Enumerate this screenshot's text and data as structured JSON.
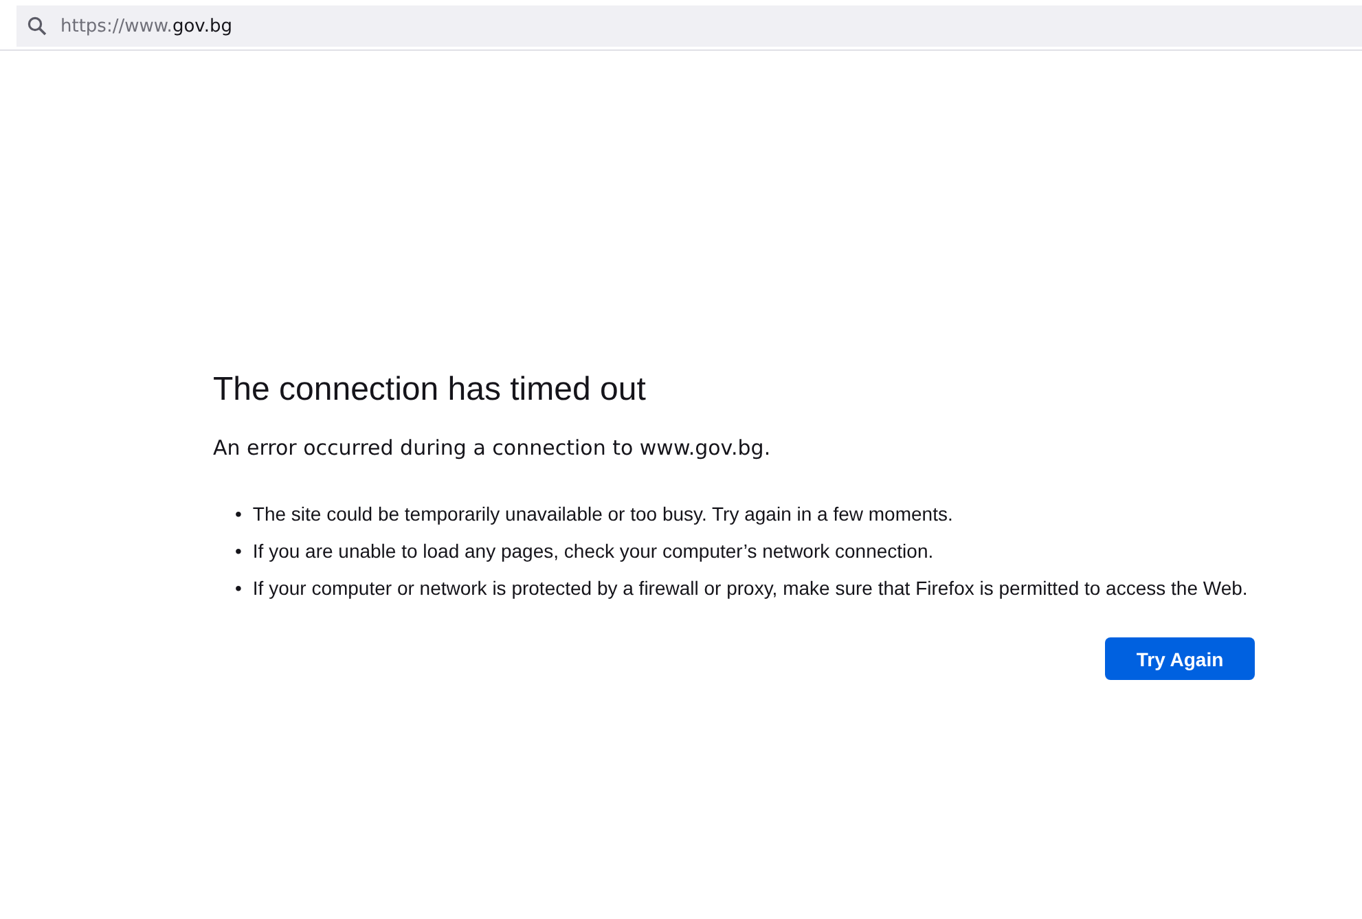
{
  "address_bar": {
    "url_prefix": "https://www.",
    "url_domain": "gov.bg"
  },
  "error": {
    "title": "The connection has timed out",
    "description": "An error occurred during a connection to www.gov.bg.",
    "tips": [
      {
        "bullet": "•",
        "text": "The site could be temporarily unavailable or too busy. Try again in a few moments."
      },
      {
        "bullet": "•",
        "text": "If you are unable to load any pages, check your computer’s network connection."
      },
      {
        "bullet": "•",
        "text": "If your computer or network is protected by a firewall or proxy, make sure that Firefox is permitted to access the Web."
      }
    ],
    "button": "Try Again"
  }
}
